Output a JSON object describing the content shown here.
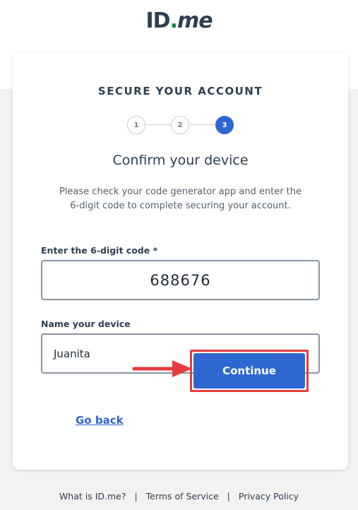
{
  "brand": {
    "logo_id": "ID",
    "logo_dot": ".",
    "logo_me": "me"
  },
  "card": {
    "heading": "SECURE YOUR ACCOUNT",
    "steps": [
      "1",
      "2",
      "3"
    ],
    "active_step": 3,
    "title": "Confirm your device",
    "description": "Please check your code generator app and enter the 6-digit code to complete securing your account."
  },
  "form": {
    "code_label": "Enter the 6-digit code *",
    "code_value": "688676",
    "device_label": "Name your device",
    "device_value": "Juanita"
  },
  "actions": {
    "go_back": "Go back",
    "continue": "Continue"
  },
  "footer": {
    "links": [
      "What is ID.me?",
      "Terms of Service",
      "Privacy Policy"
    ],
    "separator": "|"
  },
  "colors": {
    "accent": "#2f67d0",
    "highlight": "#e53b3b",
    "brand_dot": "#08833d"
  }
}
